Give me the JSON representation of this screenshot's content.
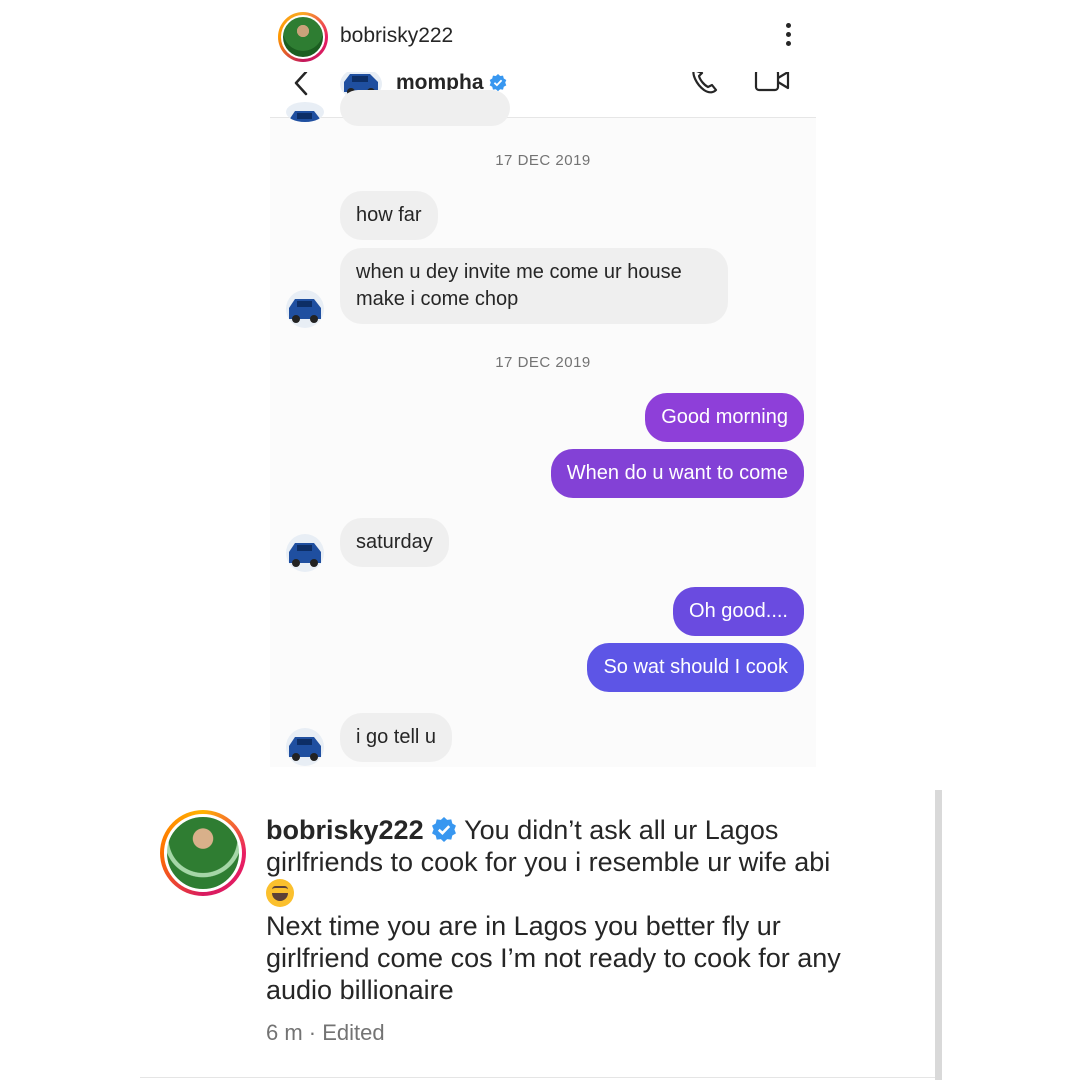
{
  "post": {
    "username": "bobrisky222"
  },
  "dm": {
    "name": "mompha",
    "messages": [
      {
        "date": "17 DEC 2019"
      },
      {
        "text": "how far"
      },
      {
        "text_line1": "when u dey invite me come ur house",
        "text_line2": "make i come chop"
      },
      {
        "date": "17 DEC 2019"
      },
      {
        "text": "Good morning"
      },
      {
        "text": "When do u want to come"
      },
      {
        "text": "saturday"
      },
      {
        "text": "Oh good...."
      },
      {
        "text": "So wat should I cook"
      },
      {
        "text": "i go tell u"
      }
    ]
  },
  "caption": {
    "username": "bobrisky222",
    "line1": "You didn’t ask all ur Lagos",
    "line2": "girlfriends to cook for you i resemble ur wife abi",
    "line3": "Next time you are in Lagos you better fly ur",
    "line4": "girlfriend come cos I’m not ready to cook for any",
    "line5": "audio billionaire",
    "meta": "6 m · Edited",
    "emoji": "laughing-emoji"
  },
  "colors": {
    "outgoing_top": "#8e3fd9",
    "outgoing_bottom": "#5d55e6",
    "incoming": "#efefef",
    "verified": "#3897f0"
  }
}
